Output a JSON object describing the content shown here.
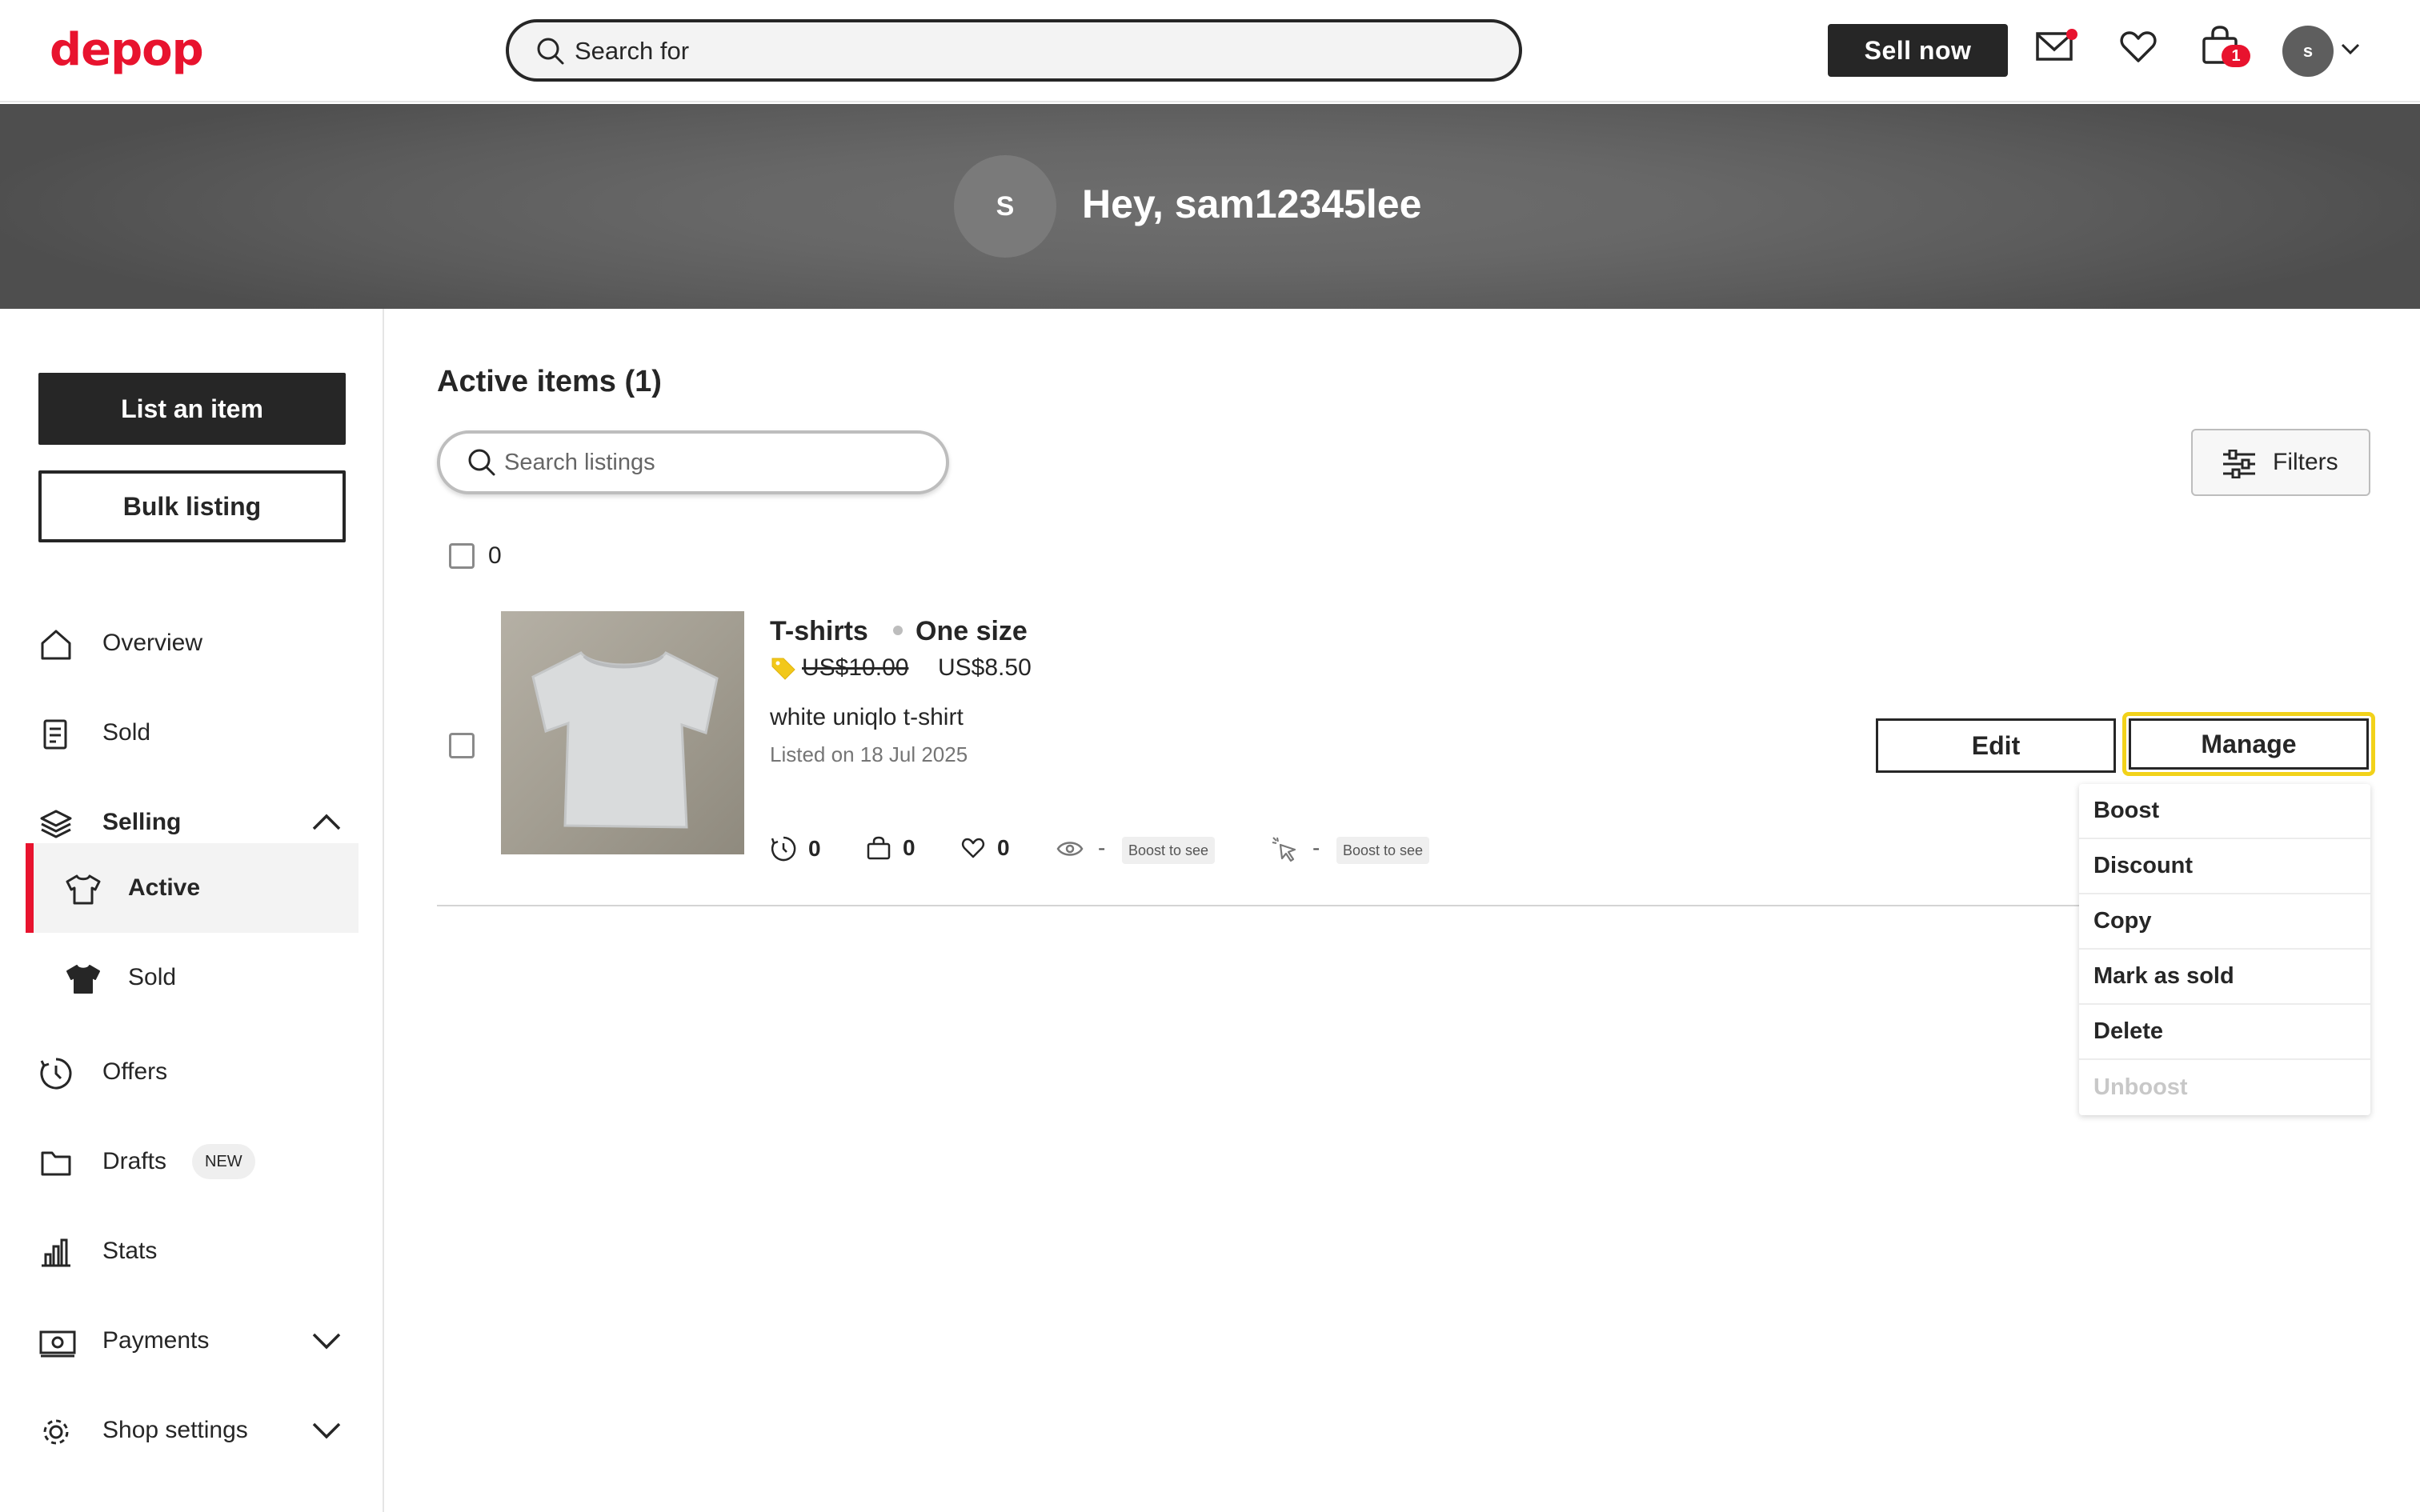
{
  "header": {
    "logo": "depop",
    "search_placeholder": "Search for",
    "sell_label": "Sell now",
    "bag_count": "1",
    "avatar_initial": "s"
  },
  "banner": {
    "avatar_initial": "S",
    "greeting": "Hey, sam12345lee"
  },
  "sidebar": {
    "list_item_label": "List an item",
    "bulk_listing_label": "Bulk listing",
    "items": [
      {
        "label": "Overview",
        "icon": "home-icon"
      },
      {
        "label": "Sold",
        "icon": "receipt-icon"
      },
      {
        "label": "Selling",
        "icon": "layers-icon",
        "expanded": true
      },
      {
        "label": "Active",
        "icon": "tshirt-outline-icon",
        "active": true
      },
      {
        "label": "Sold",
        "icon": "tshirt-filled-icon"
      },
      {
        "label": "Offers",
        "icon": "offers-icon"
      },
      {
        "label": "Drafts",
        "icon": "folder-icon",
        "badge": "NEW"
      },
      {
        "label": "Stats",
        "icon": "bar-chart-icon"
      },
      {
        "label": "Payments",
        "icon": "money-icon"
      },
      {
        "label": "Shop settings",
        "icon": "gear-icon"
      }
    ]
  },
  "main": {
    "title": "Active items (1)",
    "search_placeholder": "Search listings",
    "filters_label": "Filters",
    "selected_count": "0",
    "listing": {
      "category": "T-shirts",
      "size": "One size",
      "original_price": "US$10.00",
      "price": "US$8.50",
      "description": "white uniqlo t-shirt",
      "listed": "Listed on 18 Jul 2025",
      "offers": "0",
      "bag": "0",
      "likes": "0",
      "views_value": "-",
      "views_boost": "Boost to see",
      "clicks_value": "-",
      "clicks_boost": "Boost to see",
      "edit_label": "Edit",
      "manage_label": "Manage"
    },
    "manage_menu": [
      "Boost",
      "Discount",
      "Copy",
      "Mark as sold",
      "Delete",
      "Unboost"
    ]
  },
  "colors": {
    "brand": "#e8132e",
    "dark": "#262626",
    "highlight": "#f2d21a"
  }
}
